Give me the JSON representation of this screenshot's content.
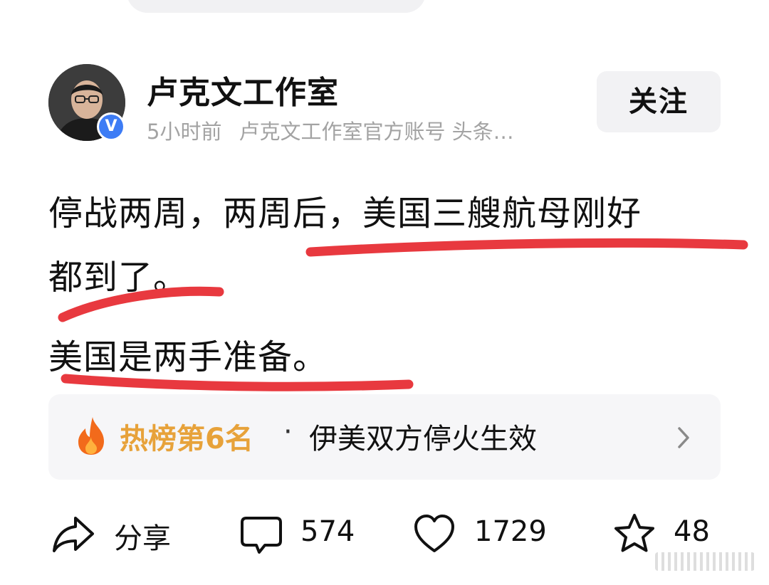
{
  "author": {
    "name": "卢克文工作室",
    "time": "5小时前",
    "description": "卢克文工作室官方账号 头条…",
    "verified_mark": "V"
  },
  "follow_button": {
    "label": "关注"
  },
  "post": {
    "lines": [
      "停战两周，两周后，美国三艘航母刚好",
      "都到了。",
      "美国是两手准备。"
    ],
    "annotation_color": "#e8393f"
  },
  "hot_list": {
    "rank_label": "热榜第6名",
    "separator": "·",
    "title": "伊美双方停火生效",
    "rank_color": "#e7a23a",
    "icons": {
      "leading": "fire-icon",
      "trailing": "chevron-right-icon"
    }
  },
  "actions": {
    "share": {
      "icon": "share-icon",
      "label": "分享"
    },
    "comment": {
      "icon": "comment-icon",
      "count": "574"
    },
    "like": {
      "icon": "heart-icon",
      "count": "1729"
    },
    "favorite": {
      "icon": "star-icon",
      "count": "48"
    }
  }
}
